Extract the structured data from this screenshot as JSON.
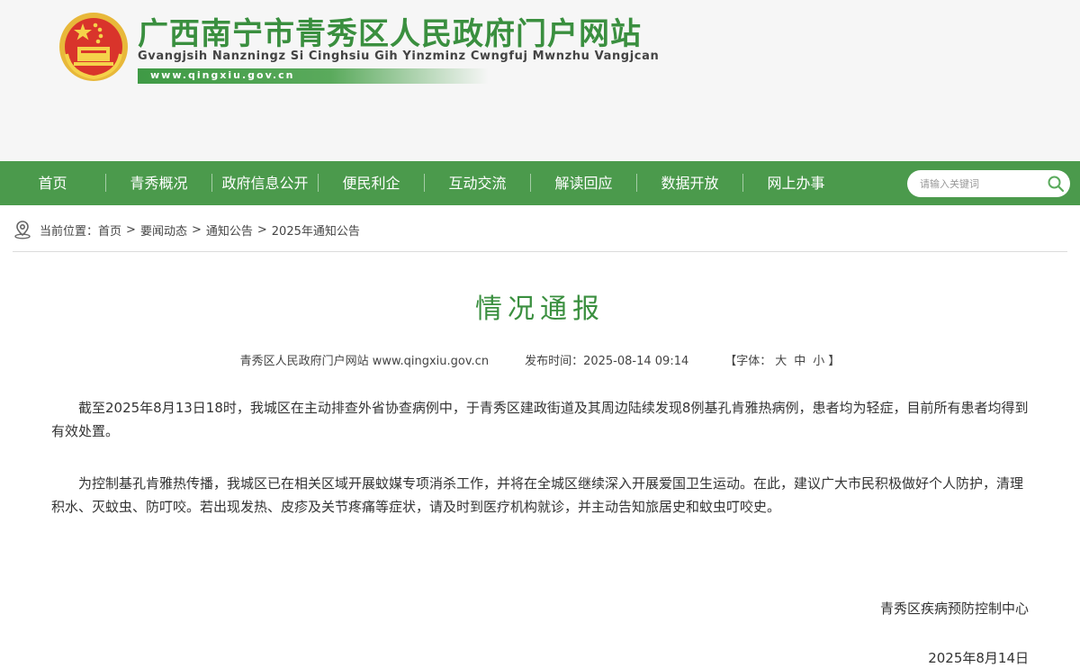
{
  "header": {
    "title": "广西南宁市青秀区人民政府门户网站",
    "subtitle": "Gvangjsih Nanzningz Si Cinghsiu Gih Yinzminz Cwngfuj Mwnzhu Vangjcan",
    "url": "www.qingxiu.gov.cn"
  },
  "nav": {
    "items": [
      {
        "label": "首页"
      },
      {
        "label": "青秀概况"
      },
      {
        "label": "政府信息公开"
      },
      {
        "label": "便民利企"
      },
      {
        "label": "互动交流"
      },
      {
        "label": "解读回应"
      },
      {
        "label": "数据开放"
      },
      {
        "label": "网上办事"
      }
    ],
    "search_placeholder": "请输入关键词"
  },
  "breadcrumb": {
    "prefix": "当前位置：",
    "items": [
      "首页",
      "要闻动态",
      "通知公告",
      "2025年通知公告"
    ],
    "separator": ">"
  },
  "article": {
    "title": "情况通报",
    "source": "青秀区人民政府门户网站 www.qingxiu.gov.cn",
    "publish_label": "发布时间：",
    "publish_time": "2025-08-14 09:14",
    "font_label_open": "【字体：",
    "font_large": "大",
    "font_medium": "中",
    "font_small": "小",
    "font_label_close": "】",
    "paragraphs": [
      "截至2025年8月13日18时，我城区在主动排查外省协查病例中，于青秀区建政街道及其周边陆续发现8例基孔肯雅热病例，患者均为轻症，目前所有患者均得到有效处置。",
      "为控制基孔肯雅热传播，我城区已在相关区域开展蚊媒专项消杀工作，并将在全城区继续深入开展爱国卫生运动。在此，建议广大市民积极做好个人防护，清理积水、灭蚊虫、防叮咬。若出现发热、皮疹及关节疼痛等症状，请及时到医疗机构就诊，并主动告知旅居史和蚊虫叮咬史。"
    ],
    "signature_org": "青秀区疾病预防控制中心",
    "signature_date": "2025年8月14日"
  },
  "colors": {
    "brand_green": "#4b9a4c",
    "title_green": "#3a8f3f"
  },
  "icons": {
    "emblem": "national-emblem-icon",
    "search": "search-icon",
    "location": "location-pin-icon"
  }
}
